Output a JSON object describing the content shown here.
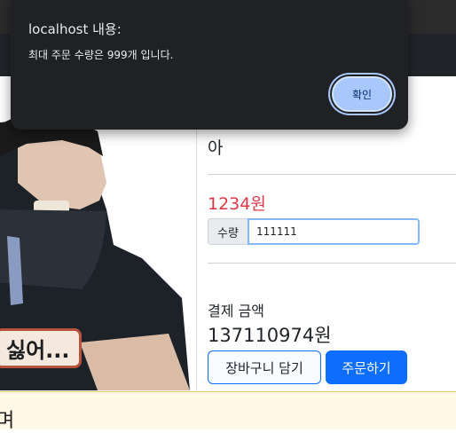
{
  "dialog": {
    "title": "localhost 내용:",
    "message": "최대 주문 수량은 999개 입니다.",
    "ok_label": "확인"
  },
  "product": {
    "name": "아",
    "price": "1234원",
    "quantity_label": "수량",
    "quantity_value": "111111",
    "total_label": "결제 금액",
    "total_value": "137110974원",
    "cart_button": "장바구니 담기",
    "order_button": "주문하기"
  },
  "image": {
    "caption": "싫어..."
  },
  "bottom": {
    "text": "며"
  },
  "colors": {
    "accent": "#0d6efd",
    "price": "#dc3545",
    "dialog_bg": "#202124",
    "dialog_button": "#a8c7fa"
  }
}
